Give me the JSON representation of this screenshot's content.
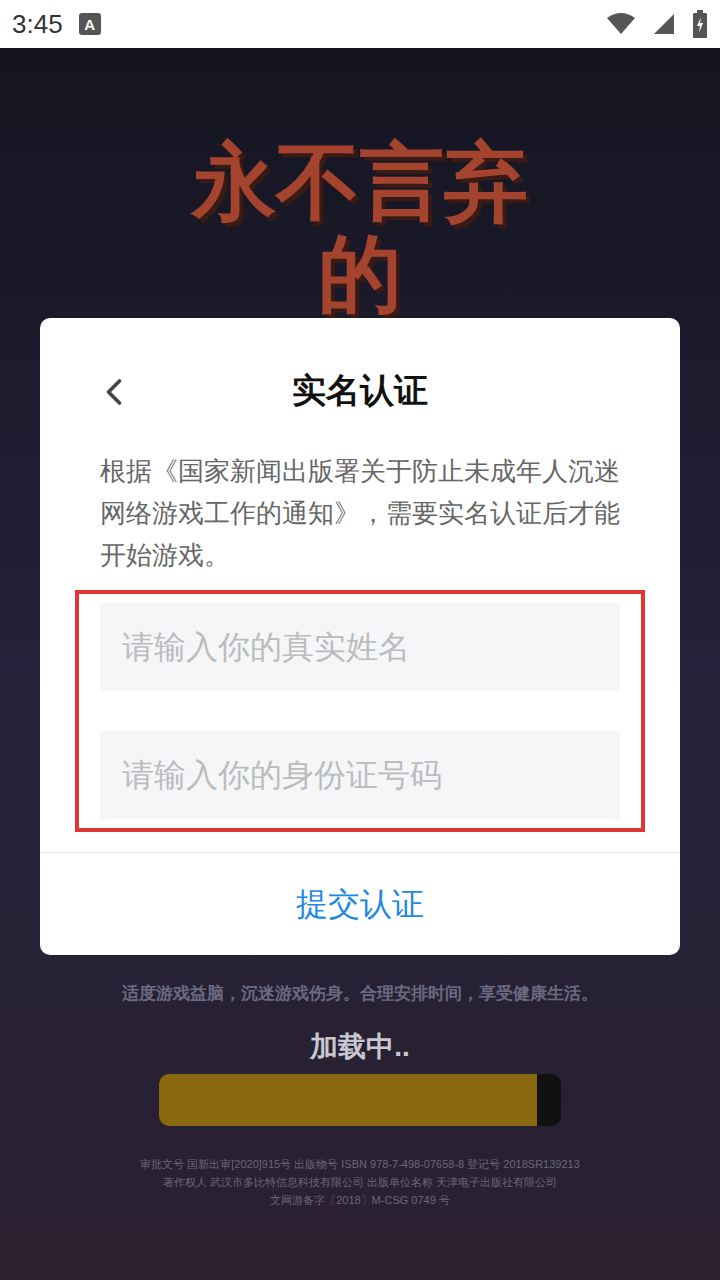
{
  "status_bar": {
    "time": "3:45",
    "notification": "A"
  },
  "background": {
    "game_title": "永不言弃的",
    "advice": "适度游戏益脑，沉迷游戏伤身。合理安排时间，享受健康生活。",
    "loading_label": "加载中..",
    "loading_level": 0.94,
    "footer_lines": [
      "审批文号 国新出审[2020]915号  出版物号 ISBN 978-7-498-07658-8  登记号 2018SR139213",
      "著作权人 武汉市多比特信息科技有限公司 出版单位名称 天津电子出版社有限公司",
      "文网游备字〔2018〕M-CSG 0749 号"
    ]
  },
  "dialog": {
    "title": "实名认证",
    "description": "根据《国家新闻出版署关于防止未成年人沉迷网络游戏工作的通知》，需要实名认证后才能开始游戏。",
    "fields_highlighted": true,
    "fields": [
      {
        "placeholder": "请输入你的真实姓名",
        "value": ""
      },
      {
        "placeholder": "请输入你的身份证号码",
        "value": ""
      }
    ],
    "submit": "提交认证"
  }
}
